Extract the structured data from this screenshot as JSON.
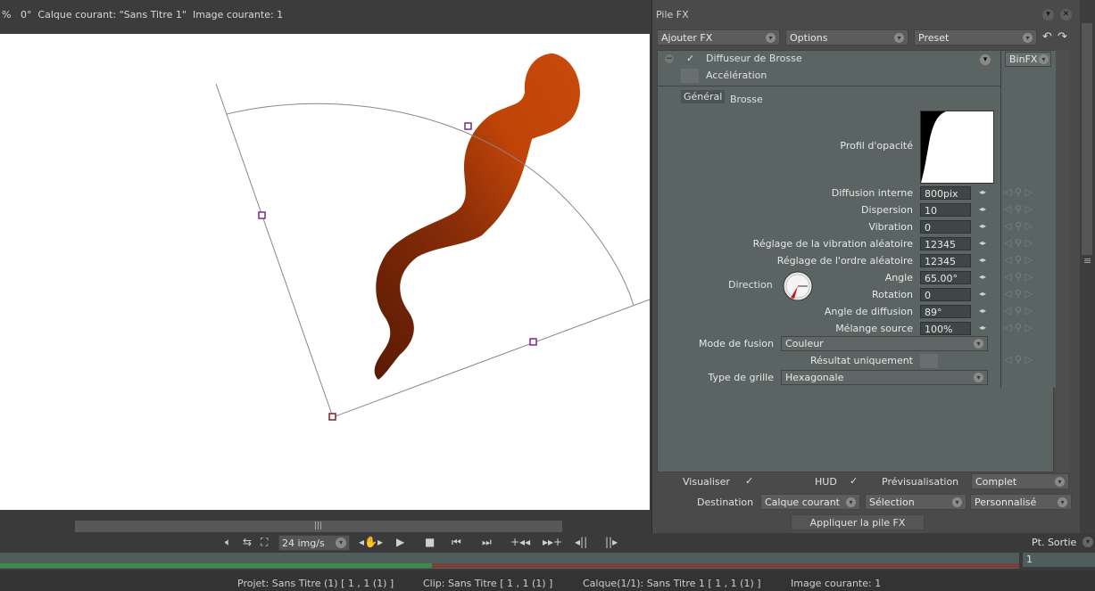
{
  "viewer": {
    "info": "%   0°  Calque courant: \"Sans Titre 1\"  Image courante: 1"
  },
  "fx_panel": {
    "title": "Pile FX",
    "toolbar": {
      "add_fx": "Ajouter FX",
      "options": "Options",
      "preset": "Preset"
    },
    "effect": {
      "name": "Diffuseur de Brosse",
      "acceleration": "Accélération",
      "binfx": "BinFX",
      "tabs": [
        "Général",
        "Brosse"
      ],
      "profile_label": "Profil d'opacité",
      "direction_label": "Direction",
      "params": [
        {
          "label": "Diffusion interne",
          "value": "800pix"
        },
        {
          "label": "Dispersion",
          "value": "10"
        },
        {
          "label": "Vibration",
          "value": "0"
        },
        {
          "label": "Réglage de la vibration aléatoire",
          "value": "12345"
        },
        {
          "label": "Réglage de l'ordre aléatoire",
          "value": "12345"
        },
        {
          "label": "Angle",
          "value": "65.00°"
        },
        {
          "label": "Rotation",
          "value": "0"
        },
        {
          "label": "Angle de diffusion",
          "value": "89°"
        },
        {
          "label": "Mélange source",
          "value": "100%"
        }
      ],
      "blend_mode_label": "Mode de fusion",
      "blend_mode_value": "Couleur",
      "result_only_label": "Résultat uniquement",
      "grid_type_label": "Type de grille",
      "grid_type_value": "Hexagonale"
    },
    "footer": {
      "visualize": "Visualiser",
      "hud": "HUD",
      "preview": "Prévisualisation",
      "preview_value": "Complet",
      "destination": "Destination",
      "dest_layer": "Calque courant",
      "dest_selection": "Sélection",
      "dest_custom": "Personnalisé",
      "apply": "Appliquer la pile FX"
    }
  },
  "transport": {
    "fps": "24 img/s",
    "out_point_label": "Pt. Sortie",
    "out_point_value": "1"
  },
  "statusbar": {
    "project": "Projet: Sans Titre (1) [ 1 , 1  (1) ]",
    "clip": "Clip: Sans Titre [ 1 , 1  (1) ]",
    "layer": "Calque(1/1): Sans Titre 1 [ 1 , 1  (1) ]",
    "frame": "Image courante: 1"
  },
  "colors": {
    "stroke_light": "#c94a0a",
    "stroke_dark": "#5a1a04",
    "handle_purple": "#7a2a8a",
    "handle_red": "#8a1a1a"
  }
}
